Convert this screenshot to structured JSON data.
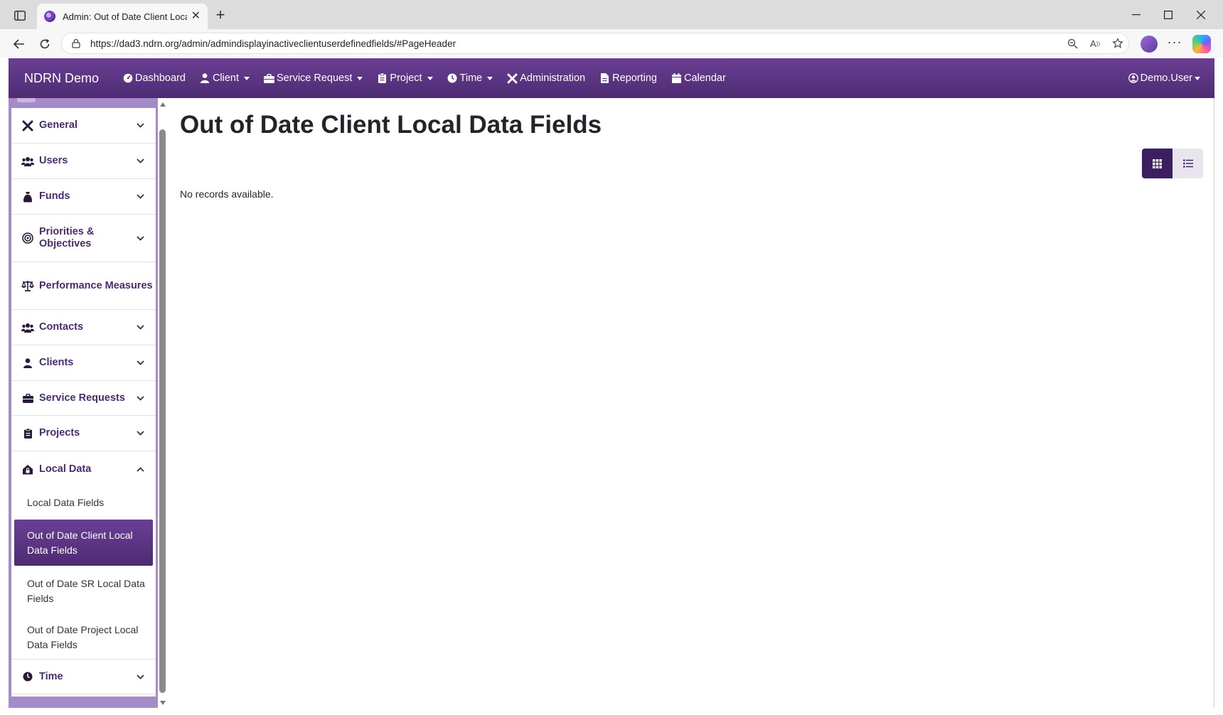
{
  "browser": {
    "tab_title": "Admin: Out of Date Client Local Data Fields",
    "url": "https://dad3.ndrn.org/admin/admindisplayinactiveclientuserdefinedfields/#PageHeader"
  },
  "navbar": {
    "brand": "NDRN Demo",
    "items": [
      {
        "label": "Dashboard",
        "icon": "dashboard-icon",
        "dropdown": false
      },
      {
        "label": "Client",
        "icon": "user-icon",
        "dropdown": true
      },
      {
        "label": "Service Request",
        "icon": "briefcase-icon",
        "dropdown": true
      },
      {
        "label": "Project",
        "icon": "clipboard-icon",
        "dropdown": true
      },
      {
        "label": "Time",
        "icon": "clock-icon",
        "dropdown": true
      },
      {
        "label": "Administration",
        "icon": "tools-icon",
        "dropdown": false
      },
      {
        "label": "Reporting",
        "icon": "file-icon",
        "dropdown": false
      },
      {
        "label": "Calendar",
        "icon": "calendar-icon",
        "dropdown": false
      }
    ],
    "user": "Demo.User"
  },
  "sidebar": {
    "sections": [
      {
        "label": "General",
        "icon": "tools-icon",
        "expandable": true
      },
      {
        "label": "Users",
        "icon": "users-icon",
        "expandable": true
      },
      {
        "label": "Funds",
        "icon": "money-bag-icon",
        "expandable": true
      },
      {
        "label": "Priorities & Objectives",
        "icon": "bullseye-icon",
        "expandable": true
      },
      {
        "label": "Performance Measures",
        "icon": "scale-icon",
        "expandable": false
      },
      {
        "label": "Contacts",
        "icon": "users-icon",
        "expandable": true
      },
      {
        "label": "Clients",
        "icon": "user-icon",
        "expandable": true
      },
      {
        "label": "Service Requests",
        "icon": "briefcase-icon",
        "expandable": true
      },
      {
        "label": "Projects",
        "icon": "clipboard-icon",
        "expandable": true
      },
      {
        "label": "Local Data",
        "icon": "house-lock-icon",
        "expandable": true,
        "expanded": true
      },
      {
        "label": "Time",
        "icon": "clock-icon",
        "expandable": true
      }
    ],
    "local_data_items": [
      {
        "label": "Local Data Fields",
        "active": false
      },
      {
        "label": "Out of Date Client Local Data Fields",
        "active": true
      },
      {
        "label": "Out of Date SR Local Data Fields",
        "active": false
      },
      {
        "label": "Out of Date Project Local Data Fields",
        "active": false
      }
    ]
  },
  "main": {
    "title": "Out of Date Client Local Data Fields",
    "empty_message": "No records available.",
    "view_mode": "grid"
  }
}
